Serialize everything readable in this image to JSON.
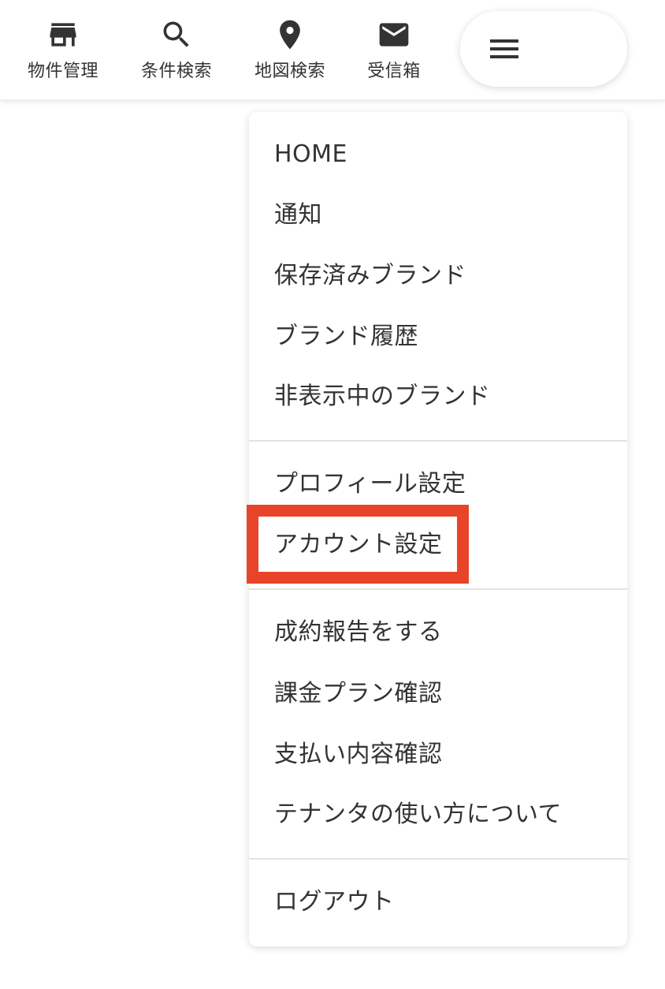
{
  "nav": {
    "items": [
      {
        "label": "物件管理",
        "icon": "store-icon"
      },
      {
        "label": "条件検索",
        "icon": "search-icon"
      },
      {
        "label": "地図検索",
        "icon": "map-pin-icon"
      },
      {
        "label": "受信箱",
        "icon": "mail-icon"
      }
    ],
    "menu_icon": "hamburger-menu-icon"
  },
  "menu": {
    "group1": [
      "HOME",
      "通知",
      "保存済みブランド",
      "ブランド履歴",
      "非表示中のブランド"
    ],
    "group2": [
      "プロフィール設定",
      "アカウント設定"
    ],
    "group3": [
      "成約報告をする",
      "課金プラン確認",
      "支払い内容確認",
      "テナンタの使い方について"
    ],
    "group4": [
      "ログアウト"
    ]
  },
  "colors": {
    "highlight": "#e8442a",
    "text": "#333333",
    "divider": "#e3e3e3"
  }
}
